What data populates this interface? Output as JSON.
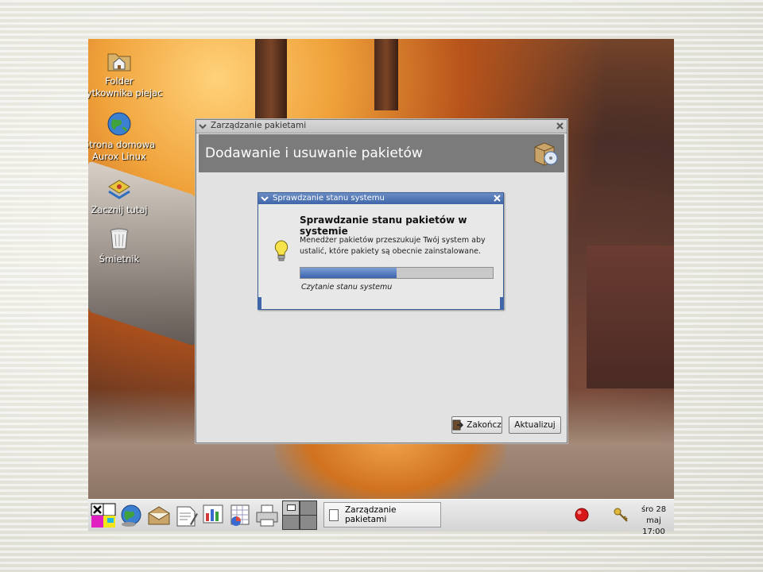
{
  "desktop": {
    "icons": [
      {
        "label_line1": "Folder",
        "label_line2": "użytkownika piejac"
      },
      {
        "label_line1": "Strona domowa",
        "label_line2": "Aurox Linux"
      },
      {
        "label_line1": "Zacznij tutaj",
        "label_line2": ""
      },
      {
        "label_line1": "Śmietnik",
        "label_line2": ""
      }
    ]
  },
  "main_window": {
    "title": "Zarządzanie pakietami",
    "header": "Dodawanie i usuwanie pakietów",
    "buttons": {
      "quit_label": "Zakończ",
      "update_label": "Aktualizuj"
    }
  },
  "dialog": {
    "title": "Sprawdzanie stanu systemu",
    "heading": "Sprawdzanie stanu pakietów w systemie",
    "message": "Menedżer pakietów przeszukuje Twój system aby ustalić, które pakiety są obecnie zainstalowane.",
    "progress_fraction": 0.5,
    "status": "Czytanie stanu systemu"
  },
  "taskbar": {
    "task_label": "Zarządzanie pakietami",
    "clock_line1": "śro 28 maj",
    "clock_line2": "17:00"
  },
  "colors": {
    "dialog_title": "#3e66a8",
    "progress": "#3c64ae",
    "header_bg": "#7b7b7b"
  }
}
